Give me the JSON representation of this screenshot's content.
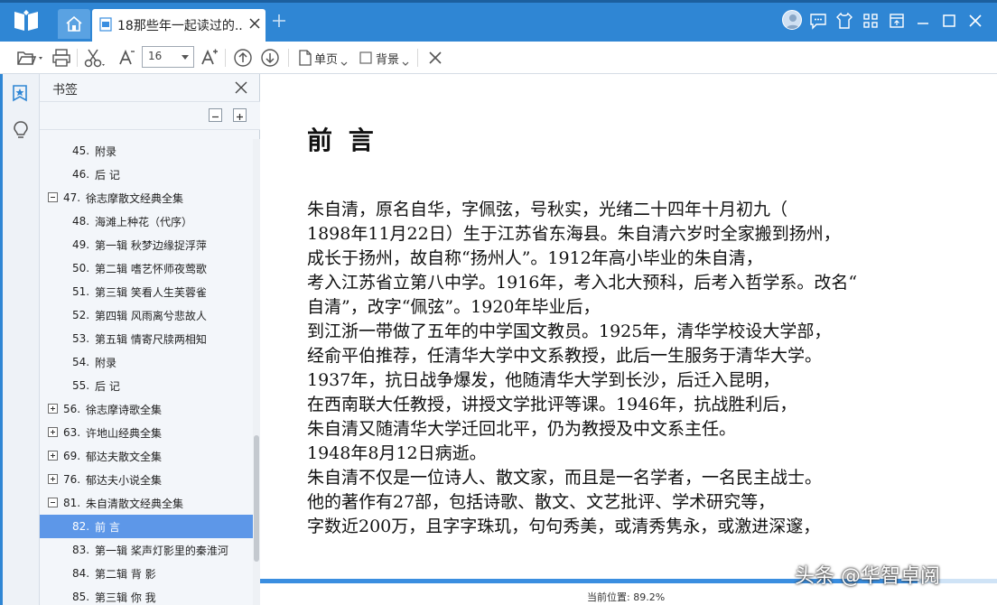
{
  "window": {
    "doc_tab_title": "18那些年一起读过的...",
    "accent": "#2f86d4"
  },
  "titlebar_icons": [
    "home-icon",
    "document-icon",
    "close-icon",
    "plus-icon",
    "avatar",
    "message-icon",
    "shirt-icon",
    "grid-icon",
    "restore-icon",
    "minimize-icon",
    "maximize-icon",
    "close-icon"
  ],
  "toolbar": {
    "font_size": "16",
    "single_page_label": "单页",
    "background_label": "背景"
  },
  "panel": {
    "title": "书签"
  },
  "bookmarks": [
    {
      "num": "45.",
      "label": "附录",
      "level": 2,
      "expander": ""
    },
    {
      "num": "46.",
      "label": "后 记",
      "level": 2,
      "expander": ""
    },
    {
      "num": "47.",
      "label": "徐志摩散文经典全集",
      "level": 1,
      "expander": "minus"
    },
    {
      "num": "48.",
      "label": "海滩上种花（代序）",
      "level": 2,
      "expander": ""
    },
    {
      "num": "49.",
      "label": "第一辑  秋梦边缘捉浮萍",
      "level": 2,
      "expander": ""
    },
    {
      "num": "50.",
      "label": "第二辑  嗜艺怀师夜莺歌",
      "level": 2,
      "expander": ""
    },
    {
      "num": "51.",
      "label": "第三辑  笑看人生芙蓉雀",
      "level": 2,
      "expander": ""
    },
    {
      "num": "52.",
      "label": "第四辑  风雨离兮悲故人",
      "level": 2,
      "expander": ""
    },
    {
      "num": "53.",
      "label": "第五辑  情寄尺牍两相知",
      "level": 2,
      "expander": ""
    },
    {
      "num": "54.",
      "label": "附录",
      "level": 2,
      "expander": ""
    },
    {
      "num": "55.",
      "label": "后 记",
      "level": 2,
      "expander": ""
    },
    {
      "num": "56.",
      "label": "徐志摩诗歌全集",
      "level": 1,
      "expander": "plus"
    },
    {
      "num": "63.",
      "label": "许地山经典全集",
      "level": 1,
      "expander": "plus"
    },
    {
      "num": "69.",
      "label": "郁达夫散文全集",
      "level": 1,
      "expander": "plus"
    },
    {
      "num": "76.",
      "label": "郁达夫小说全集",
      "level": 1,
      "expander": "plus"
    },
    {
      "num": "81.",
      "label": "朱自清散文经典全集",
      "level": 1,
      "expander": "minus"
    },
    {
      "num": "82.",
      "label": "前 言",
      "level": 2,
      "expander": "",
      "selected": true
    },
    {
      "num": "83.",
      "label": "第一辑  桨声灯影里的秦淮河",
      "level": 2,
      "expander": ""
    },
    {
      "num": "84.",
      "label": "第二辑  背 影",
      "level": 2,
      "expander": ""
    },
    {
      "num": "85.",
      "label": "第三辑  你 我",
      "level": 2,
      "expander": ""
    }
  ],
  "document": {
    "title": "前 言",
    "lines": [
      "朱自清，原名自华，字佩弦，号秋实，光绪二十四年十月初九（",
      "1898年11月22日）生于江苏省东海县。朱自清六岁时全家搬到扬州，",
      "成长于扬州，故自称“扬州人”。1912年高小毕业的朱自清，",
      "考入江苏省立第八中学。1916年，考入北大预科，后考入哲学系。改名“",
      "自清”，改字“佩弦”。1920年毕业后，",
      "到江浙一带做了五年的中学国文教员。1925年，清华学校设大学部，",
      "经俞平伯推荐，任清华大学中文系教授，此后一生服务于清华大学。",
      "1937年，抗日战争爆发，他随清华大学到长沙，后迁入昆明，",
      "在西南联大任教授，讲授文学批评等课。1946年，抗战胜利后，",
      "朱自清又随清华大学迁回北平，仍为教授及中文系主任。",
      "1948年8月12日病逝。",
      "朱自清不仅是一位诗人、散文家，而且是一名学者，一名民主战士。",
      "他的著作有27部，包括诗歌、散文、文艺批评、学术研究等，",
      "字数近200万，且字字珠玑，句句秀美，或清秀隽永，或激进深邃，"
    ]
  },
  "status": {
    "position_text": "当前位置: 89.2%",
    "progress_percent": 89.2
  },
  "watermark": "头条 @华智卓阅"
}
